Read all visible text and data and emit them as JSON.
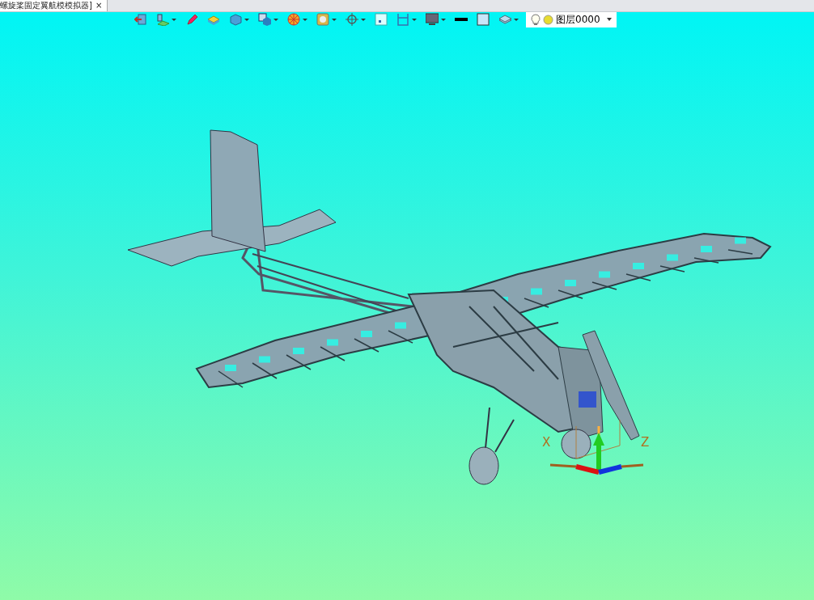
{
  "tab": {
    "title": "螺旋桨固定翼航模模拟器]",
    "close": "×",
    "selected": true
  },
  "toolbar": [
    {
      "kind": "exit",
      "dropdown": false
    },
    {
      "kind": "sketch",
      "dropdown": true
    },
    {
      "kind": "pen",
      "dropdown": false
    },
    {
      "kind": "box",
      "dropdown": false
    },
    {
      "kind": "cube",
      "dropdown": true
    },
    {
      "kind": "view",
      "dropdown": true
    },
    {
      "kind": "render",
      "dropdown": true
    },
    {
      "kind": "material",
      "dropdown": true
    },
    {
      "kind": "crosshair",
      "dropdown": true
    },
    {
      "kind": "square",
      "dropdown": false
    },
    {
      "kind": "frame",
      "dropdown": true
    },
    {
      "kind": "monitor",
      "dropdown": true
    },
    {
      "kind": "line",
      "dropdown": false
    },
    {
      "kind": "fill",
      "dropdown": false
    },
    {
      "kind": "layers",
      "dropdown": true
    }
  ],
  "layer": {
    "value": "图层0000"
  },
  "axes": {
    "x_label": "X",
    "z_label": "Z"
  }
}
